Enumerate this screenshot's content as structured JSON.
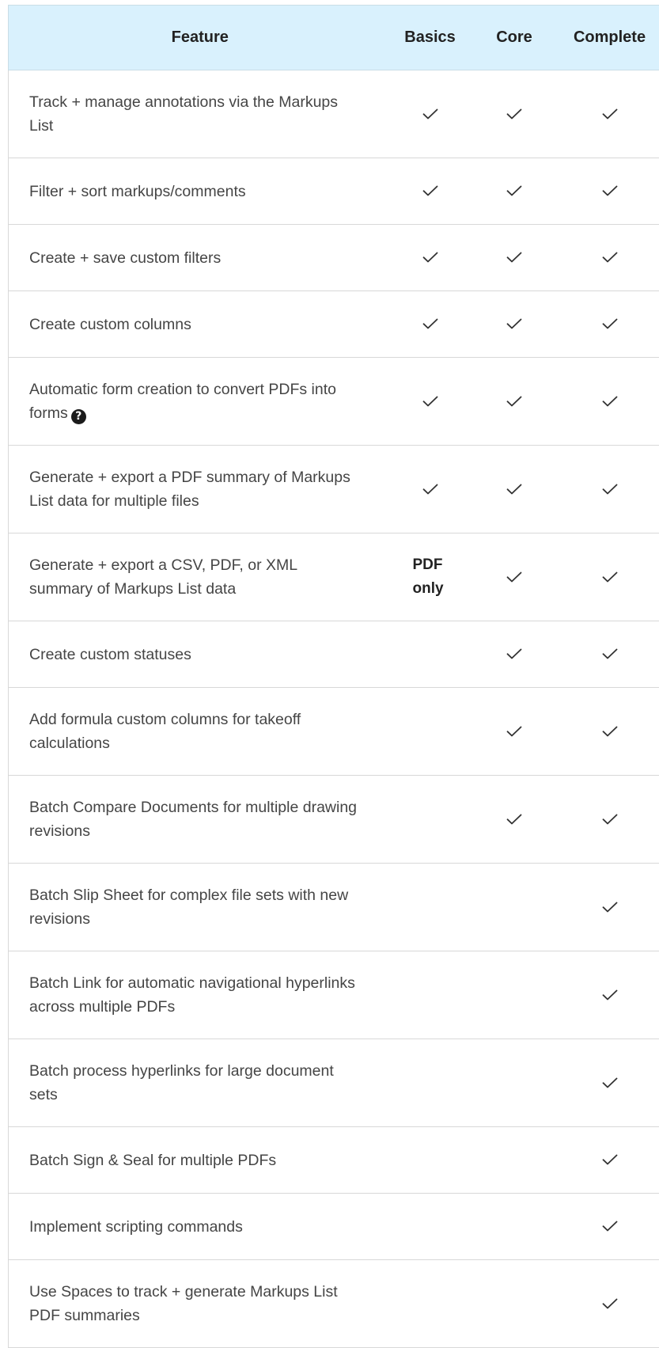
{
  "header": {
    "feature": "Feature",
    "basics": "Basics",
    "core": "Core",
    "complete": "Complete"
  },
  "rows": [
    {
      "feature": "Track + manage annotations via the Markups List",
      "basics": "check",
      "core": "check",
      "complete": "check",
      "help": false
    },
    {
      "feature": "Filter + sort markups/comments",
      "basics": "check",
      "core": "check",
      "complete": "check",
      "help": false
    },
    {
      "feature": "Create + save custom filters",
      "basics": "check",
      "core": "check",
      "complete": "check",
      "help": false
    },
    {
      "feature": "Create custom columns",
      "basics": "check",
      "core": "check",
      "complete": "check",
      "help": false
    },
    {
      "feature": "Automatic form creation to convert PDFs into forms",
      "basics": "check",
      "core": "check",
      "complete": "check",
      "help": true
    },
    {
      "feature": "Generate + export a PDF summary of Markups List data for multiple files",
      "basics": "check",
      "core": "check",
      "complete": "check",
      "help": false
    },
    {
      "feature": "Generate + export a CSV, PDF, or XML summary of Markups List data",
      "basics": "PDF only",
      "core": "check",
      "complete": "check",
      "help": false
    },
    {
      "feature": "Create custom statuses",
      "basics": "",
      "core": "check",
      "complete": "check",
      "help": false
    },
    {
      "feature": "Add formula custom columns for takeoff calculations",
      "basics": "",
      "core": "check",
      "complete": "check",
      "help": false
    },
    {
      "feature": "Batch Compare Documents for multiple drawing revisions",
      "basics": "",
      "core": "check",
      "complete": "check",
      "help": false
    },
    {
      "feature": "Batch Slip Sheet for complex file sets with new revisions",
      "basics": "",
      "core": "",
      "complete": "check",
      "help": false
    },
    {
      "feature": "Batch Link for automatic navigational hyperlinks across multiple PDFs",
      "basics": "",
      "core": "",
      "complete": "check",
      "help": false
    },
    {
      "feature": "Batch process hyperlinks for large document sets",
      "basics": "",
      "core": "",
      "complete": "check",
      "help": false
    },
    {
      "feature": "Batch Sign & Seal for multiple PDFs",
      "basics": "",
      "core": "",
      "complete": "check",
      "help": false
    },
    {
      "feature": "Implement scripting commands",
      "basics": "",
      "core": "",
      "complete": "check",
      "help": false
    },
    {
      "feature": "Use Spaces to track + generate Markups List PDF summaries",
      "basics": "",
      "core": "",
      "complete": "check",
      "help": false
    }
  ],
  "icons": {
    "check": "check-icon",
    "help": "question-circle-icon"
  },
  "colors": {
    "header_bg": "#d9f1fd",
    "divider": "#d8d8d8",
    "text": "#454545"
  }
}
